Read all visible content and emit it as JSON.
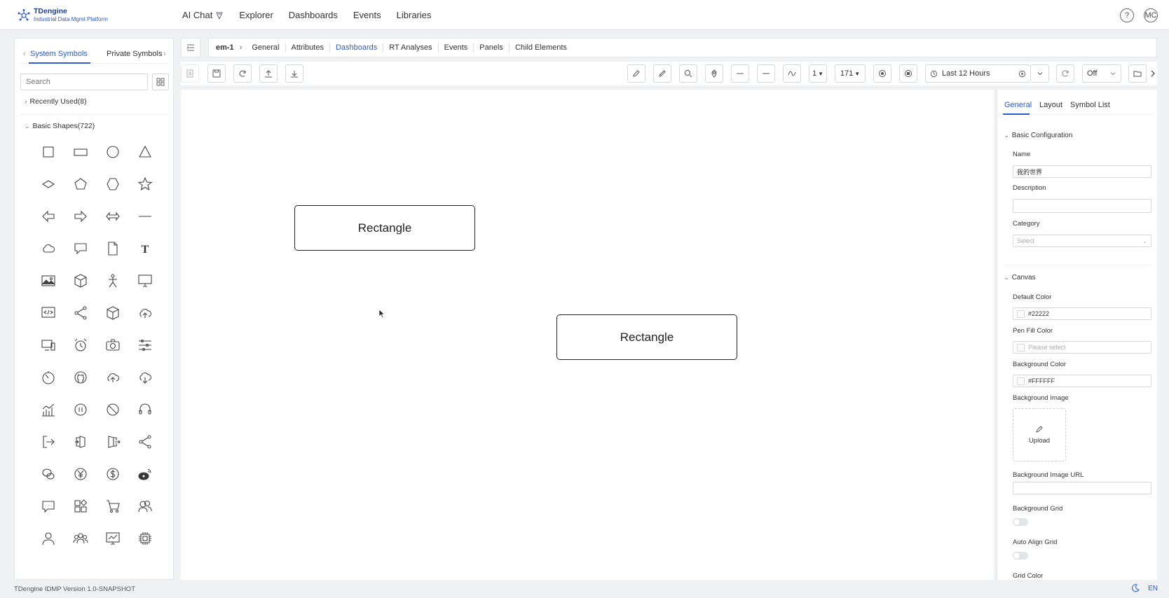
{
  "app": {
    "logo_title": "TDengine",
    "logo_subtitle": "Industrial Data Mgmt Platform",
    "user_initials": "MC"
  },
  "nav": {
    "ai_chat": "AI Chat",
    "explorer": "Explorer",
    "dashboards": "Dashboards",
    "events": "Events",
    "libraries": "Libraries"
  },
  "symbols": {
    "tab_system": "System Symbols",
    "tab_private": "Private Symbols",
    "search_placeholder": "Search",
    "recently_used": "Recently Used(8)",
    "basic_shapes": "Basic Shapes(722)",
    "icons": [
      "square-icon",
      "rectangle-icon",
      "circle-icon",
      "triangle-icon",
      "diamond-icon",
      "pentagon-icon",
      "hexagon-icon",
      "star-icon",
      "arrow-left-icon",
      "arrow-right-icon",
      "double-arrow-icon",
      "line-icon",
      "cloud-icon",
      "speech-bubble-icon",
      "document-icon",
      "text-icon",
      "image-icon",
      "cube-icon",
      "person-icon",
      "monitor-icon",
      "code-icon",
      "share-icon",
      "box-icon",
      "cloud-upload-icon",
      "computer-icon",
      "alarm-clock-icon",
      "camera-icon",
      "sliders-icon",
      "timer-icon",
      "github-icon",
      "upload-cloud-icon",
      "download-cloud-icon",
      "bar-chart-icon",
      "pause-icon",
      "block-icon",
      "headset-icon",
      "logout-icon",
      "door-in-icon",
      "door-out-icon",
      "share-nodes-icon",
      "wechat-icon",
      "yen-icon",
      "dollar-icon",
      "weibo-icon",
      "message-icon",
      "apps-icon",
      "cart-icon",
      "users-icon",
      "user-icon",
      "team-icon",
      "monitor-chart-icon",
      "chip-icon"
    ]
  },
  "breadcrumb": {
    "root": "em-1",
    "items": [
      "General",
      "Attributes",
      "Dashboards",
      "RT Analyses",
      "Events",
      "Panels",
      "Child Elements"
    ],
    "active": "Dashboards"
  },
  "toolbar": {
    "line_width": "1",
    "size": "171",
    "time_range": "Last 12 Hours",
    "refresh": "Off"
  },
  "canvas": {
    "shapes": [
      {
        "label": "Rectangle"
      },
      {
        "label": "Rectangle"
      }
    ]
  },
  "props": {
    "tab_general": "General",
    "tab_layout": "Layout",
    "tab_symbols": "Symbol List",
    "basic_config": "Basic Configuration",
    "name_label": "Name",
    "name_value": "我的世界",
    "description_label": "Description",
    "category_label": "Category",
    "category_placeholder": "Select",
    "canvas_section": "Canvas",
    "default_color_label": "Default Color",
    "default_color_value": "#22222",
    "pen_fill_label": "Pen Fill Color",
    "pen_fill_placeholder": "Please select",
    "bg_color_label": "Background Color",
    "bg_color_value": "#FFFFFF",
    "bg_image_label": "Background Image",
    "upload_label": "Upload",
    "bg_image_url_label": "Background Image URL",
    "bg_grid_label": "Background Grid",
    "auto_align_label": "Auto Align Grid",
    "grid_color_label": "Grid Color"
  },
  "footer": {
    "version": "TDengine IDMP Version 1.0-SNAPSHOT",
    "lang": "EN"
  },
  "colors": {
    "accent": "#2b5bd7",
    "border": "#d5d8dc"
  }
}
